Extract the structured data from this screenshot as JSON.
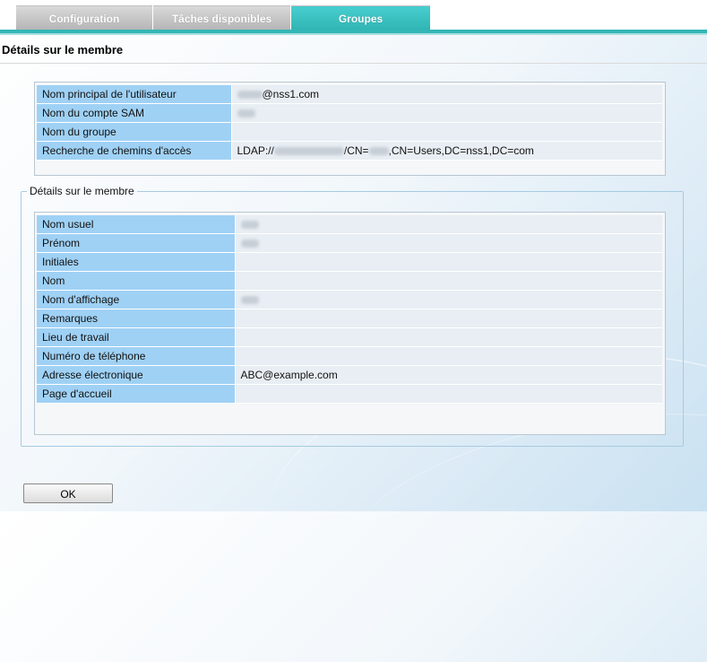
{
  "tabs": [
    {
      "label": "Configuration"
    },
    {
      "label": "Tâches disponibles"
    },
    {
      "label": "Groupes",
      "active": true
    }
  ],
  "page_title": "Détails sur le membre",
  "account_info": [
    {
      "label": "Nom principal de l'utilisateur",
      "value": "@nss1.com"
    },
    {
      "label": "Nom du compte SAM",
      "value": ""
    },
    {
      "label": "Nom du groupe",
      "value": ""
    },
    {
      "label": "Recherche de chemins d'accès",
      "value_prefix": "LDAP://",
      "value_mid": "/CN=",
      "value_suffix": ",CN=Users,DC=nss1,DC=com"
    }
  ],
  "member_details": {
    "legend": "Détails sur le membre",
    "rows": [
      {
        "label": "Nom usuel",
        "value": ""
      },
      {
        "label": "Prénom",
        "value": ""
      },
      {
        "label": "Initiales",
        "value": ""
      },
      {
        "label": "Nom",
        "value": ""
      },
      {
        "label": "Nom d'affichage",
        "value": ""
      },
      {
        "label": "Remarques",
        "value": ""
      },
      {
        "label": "Lieu de travail",
        "value": ""
      },
      {
        "label": "Numéro de téléphone",
        "value": ""
      },
      {
        "label": "Adresse électronique",
        "value": "ABC@example.com"
      },
      {
        "label": "Page d'accueil",
        "value": ""
      }
    ]
  },
  "buttons": {
    "ok": "OK"
  },
  "colors": {
    "tab_active": "#34b6b6",
    "label_cell": "#9fd1f5",
    "value_cell": "#e8eef3"
  }
}
